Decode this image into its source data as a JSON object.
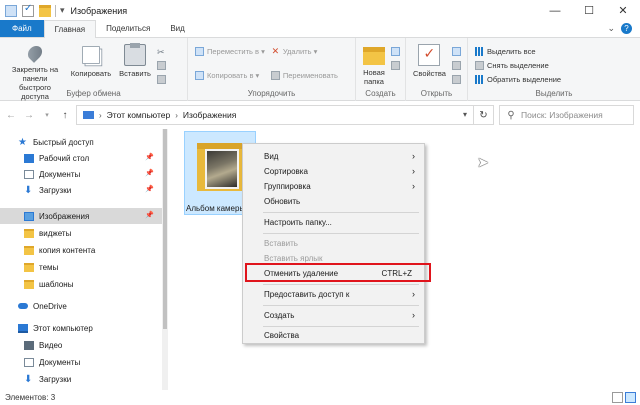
{
  "window": {
    "title": "Изображения",
    "controls": {
      "minimize": "—",
      "maximize": "☐",
      "close": "✕"
    }
  },
  "ribbon_tabs": {
    "file": "Файл",
    "home": "Главная",
    "share": "Поделиться",
    "view": "Вид"
  },
  "ribbon": {
    "clipboard": {
      "label": "Буфер обмена",
      "pin": "Закрепить на панели быстрого доступа",
      "copy": "Копировать",
      "paste": "Вставить"
    },
    "organize": {
      "label": "Упорядочить",
      "move_to": "Переместить в ▾",
      "copy_to": "Копировать в ▾",
      "delete": "Удалить ▾",
      "rename": "Переименовать"
    },
    "create": {
      "label": "Создать",
      "new_folder": "Новая папка"
    },
    "open": {
      "label": "Открыть",
      "properties": "Свойства"
    },
    "select": {
      "label": "Выделить",
      "select_all": "Выделить все",
      "select_none": "Снять выделение",
      "invert": "Обратить выделение"
    }
  },
  "address": {
    "crumbs": [
      "Этот компьютер",
      "Изображения"
    ],
    "separator": "›",
    "search_placeholder": "Поиск: Изображения"
  },
  "nav_pane": {
    "items": [
      {
        "label": "Быстрый доступ",
        "icon": "star-icon"
      },
      {
        "label": "Рабочий стол",
        "icon": "desktop-icon",
        "pinned": true
      },
      {
        "label": "Документы",
        "icon": "documents-icon",
        "pinned": true
      },
      {
        "label": "Загрузки",
        "icon": "download-icon",
        "pinned": true
      },
      {
        "label": "Изображения",
        "icon": "pictures-icon",
        "pinned": true,
        "selected": true
      },
      {
        "label": "виджеты",
        "icon": "folder-icon"
      },
      {
        "label": "копия контента",
        "icon": "folder-icon"
      },
      {
        "label": "темы",
        "icon": "folder-icon"
      },
      {
        "label": "шаблоны",
        "icon": "folder-icon"
      },
      {
        "label": "OneDrive",
        "icon": "cloud-icon"
      },
      {
        "label": "Этот компьютер",
        "icon": "computer-icon"
      },
      {
        "label": "Видео",
        "icon": "video-icon"
      },
      {
        "label": "Документы",
        "icon": "documents-icon"
      },
      {
        "label": "Загрузки",
        "icon": "download-icon"
      }
    ]
  },
  "content": {
    "items": [
      {
        "label": "Альбом камеры",
        "selected": true
      }
    ]
  },
  "context_menu": {
    "view": "Вид",
    "sort": "Сортировка",
    "group": "Группировка",
    "refresh": "Обновить",
    "customize": "Настроить папку...",
    "paste": "Вставить",
    "paste_shortcut": "Вставить ярлык",
    "undo_delete": "Отменить удаление",
    "undo_shortcut": "CTRL+Z",
    "share_with": "Предоставить доступ к",
    "new": "Создать",
    "properties": "Свойства",
    "highlight_color": "#e0141c"
  },
  "status": {
    "items_count": "Элементов: 3"
  },
  "colors": {
    "accent": "#1979ca",
    "selection": "#cce8ff"
  }
}
